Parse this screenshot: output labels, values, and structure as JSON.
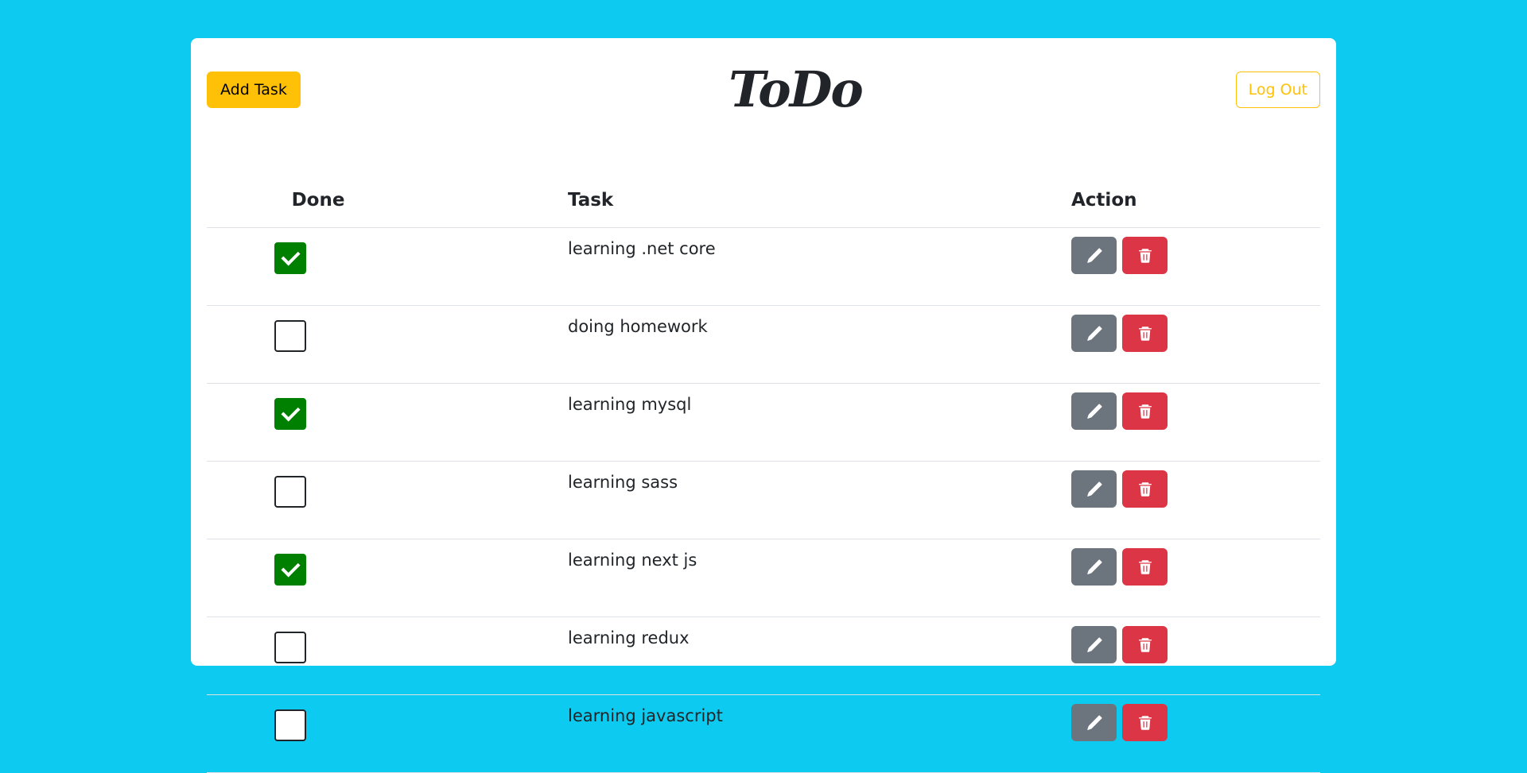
{
  "header": {
    "add_task_label": "Add Task",
    "logo_text": "ToDo",
    "logout_label": "Log Out"
  },
  "table": {
    "columns": [
      "Done",
      "Task",
      "Action"
    ],
    "rows": [
      {
        "done": true,
        "task": "learning .net core"
      },
      {
        "done": false,
        "task": "doing homework"
      },
      {
        "done": true,
        "task": "learning mysql"
      },
      {
        "done": false,
        "task": "learning sass"
      },
      {
        "done": true,
        "task": "learning next js"
      },
      {
        "done": false,
        "task": "learning redux"
      },
      {
        "done": false,
        "task": "learning javascript"
      }
    ],
    "row_actions": [
      {
        "icon": "pencil-icon",
        "color": "#6c757d"
      },
      {
        "icon": "trash-icon",
        "color": "#dc3545"
      }
    ]
  },
  "colors": {
    "background": "#0dcaf0",
    "accent": "#ffc107",
    "checked": "#008000"
  }
}
